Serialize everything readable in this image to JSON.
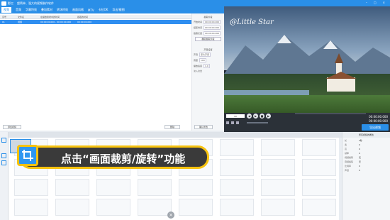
{
  "app": {
    "name": "影忆",
    "tagline": "超简单、强大的视频制作软件"
  },
  "menu": [
    "视频",
    "音频",
    "字幕特效",
    "叠加素材",
    "转场特效",
    "画面风格",
    "MTV",
    "卡拉OK",
    "导出/截图"
  ],
  "table": {
    "headers": [
      "序号",
      "文件名",
      "在播放素材中的时间",
      "截取的时间"
    ],
    "row": [
      "01",
      "视频",
      "00:00:00.000 - 00:00:00.000",
      "00:00:00.000"
    ]
  },
  "right_panel": {
    "section1_title": "截取片段",
    "fields": [
      {
        "label": "开始时间",
        "value": "00:00:00.000"
      },
      {
        "label": "结束时间",
        "value": "00:00:00.000"
      },
      {
        "label": "截取长度",
        "value": "00:00:00.000"
      }
    ],
    "confirm_btn": "确定截取片段",
    "section2_title": "声音设置",
    "sound_fields": [
      {
        "label": "声音",
        "value": "原片声音"
      },
      {
        "label": "音量",
        "value": "100"
      },
      {
        "label": "播放速度",
        "value": "1.0"
      }
    ],
    "fade_label": "淡入淡出"
  },
  "bottom_buttons": {
    "add_video": "添加视频",
    "delete": "删除",
    "confirm_edit": "确认修改"
  },
  "preview": {
    "watermark": "@Little Star"
  },
  "playback": {
    "time_start": "00:00:00.000",
    "time_end": "00:00:00.000",
    "speed": "1X"
  },
  "export_button": "导出视频",
  "props_panel": {
    "title": "所有视频的属性",
    "items": [
      {
        "key": "长",
        "value": "0秒"
      },
      {
        "key": "宽",
        "value": "0"
      },
      {
        "key": "高",
        "value": "0"
      },
      {
        "key": "帧率",
        "value": "0"
      },
      {
        "key": "视频编码",
        "value": "无"
      },
      {
        "key": "音频编码",
        "value": "无"
      },
      {
        "key": "比特率",
        "value": "0"
      },
      {
        "key": "声道",
        "value": "0"
      }
    ]
  },
  "callout": {
    "text": "点击“画面裁剪/旋转”功能"
  },
  "colors": {
    "brand_blue": "#2a8fe8",
    "callout_border": "#f6c20f",
    "callout_bg": "#3a3a3a"
  }
}
